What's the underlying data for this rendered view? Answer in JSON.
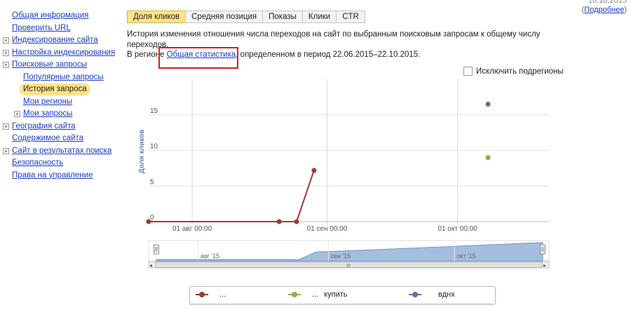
{
  "header": {
    "date": "10.10.2015",
    "details_link": "Подробнее"
  },
  "sidebar": {
    "items": [
      {
        "label": "Общая информация",
        "level": 0,
        "expander": false,
        "active": false
      },
      {
        "label": "Проверить URL",
        "level": 0,
        "expander": false,
        "active": false
      },
      {
        "label": "Индексирование сайта",
        "level": 0,
        "expander": true,
        "active": false
      },
      {
        "label": "Настройка индексирования",
        "level": 0,
        "expander": true,
        "active": false
      },
      {
        "label": "Поисковые запросы",
        "level": 0,
        "expander": true,
        "active": false
      },
      {
        "label": "Популярные запросы",
        "level": 1,
        "expander": false,
        "active": false
      },
      {
        "label": "История запроса",
        "level": 1,
        "expander": false,
        "active": true
      },
      {
        "label": "Мои регионы",
        "level": 1,
        "expander": false,
        "active": false
      },
      {
        "label": "Мои запросы",
        "level": 1,
        "expander": true,
        "active": false
      },
      {
        "label": "География сайта",
        "level": 0,
        "expander": true,
        "active": false
      },
      {
        "label": "Содержимое сайта",
        "level": 0,
        "expander": false,
        "active": false
      },
      {
        "label": "Сайт в результатах поиска",
        "level": 0,
        "expander": true,
        "active": false
      },
      {
        "label": "Безопасность",
        "level": 0,
        "expander": false,
        "active": false
      },
      {
        "label": "Права на управление",
        "level": 0,
        "expander": false,
        "active": false
      }
    ]
  },
  "tabs": [
    {
      "label": "Доля кликов",
      "active": true
    },
    {
      "label": "Средняя позиция",
      "active": false
    },
    {
      "label": "Показы",
      "active": false
    },
    {
      "label": "Клики",
      "active": false
    },
    {
      "label": "CTR",
      "active": false
    }
  ],
  "description": {
    "line1": "История изменения отношения числа переходов на сайт по выбранным поисковым запросам к общему числу переходов.",
    "region_prefix": "В регионе ",
    "region_link": "Общая статистика",
    "region_suffix": ", определенном в период 22.06.2015–22.10.2015."
  },
  "exclude_subregions": {
    "label": "Исключить подрегионы",
    "checked": false
  },
  "chart_data": {
    "type": "line",
    "ylabel": "Доля кликов",
    "xlabel": "",
    "y_ticks": [
      "0",
      "5",
      "10",
      "15"
    ],
    "x_ticks": [
      "01 авг 00:00",
      "01 сен 00:00",
      "01 окт 00:00"
    ],
    "ylim": [
      0,
      20
    ],
    "grid": true,
    "series": [
      {
        "name": "",
        "color": "#a03a34",
        "points": [
          [
            "2015-07-22",
            0
          ],
          [
            "2015-08-21",
            0
          ],
          [
            "2015-08-25",
            0
          ],
          [
            "2015-08-29",
            7.2
          ]
        ]
      },
      {
        "name": "купить",
        "color": "#8fb140",
        "points": [
          [
            "2015-10-08",
            9
          ]
        ]
      },
      {
        "name": "вднх",
        "color": "#6e6a96",
        "points": [
          [
            "2015-10-08",
            16.5
          ]
        ]
      }
    ],
    "navigator_ticks": [
      "авг '15",
      "сен '15",
      "окт '15"
    ],
    "navigator_scrollbar": "III"
  },
  "legend": {
    "items": [
      {
        "label": "",
        "ellipsis": "...",
        "color": "#a03a34"
      },
      {
        "label": "купить",
        "ellipsis": "...",
        "color": "#8fb140"
      },
      {
        "label": "вднх",
        "ellipsis": "",
        "color": "#6e6a96"
      }
    ]
  }
}
